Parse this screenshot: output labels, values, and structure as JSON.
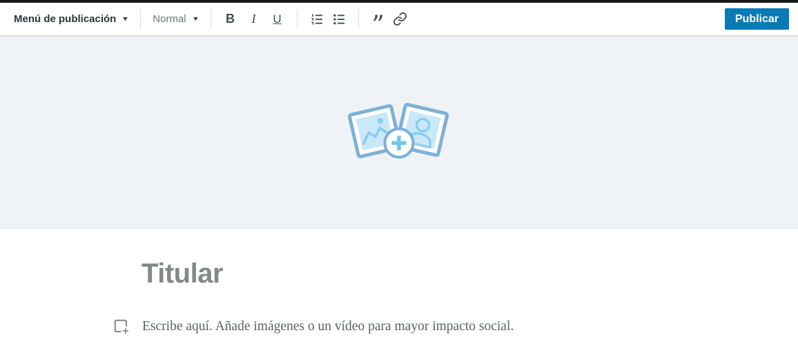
{
  "toolbar": {
    "publish_menu": {
      "label": "Menú de publicación"
    },
    "paragraph_style": {
      "label": "Normal"
    },
    "formatting": {
      "bold": "B",
      "italic": "I",
      "underline": "U"
    },
    "publish_button": {
      "label": "Publicar"
    }
  },
  "icons": {
    "chevron_down_glyph": "▼",
    "quote_glyph": "”",
    "ordered_list": "ordered-list-icon",
    "unordered_list": "unordered-list-icon",
    "link": "link-icon",
    "cover_upload": "add-images-icon",
    "inline_add_media": "add-media-icon"
  },
  "editor": {
    "title_placeholder": "Titular",
    "body_placeholder": "Escribe aquí. Añade imágenes o un vídeo para mayor impacto social."
  },
  "colors": {
    "top_bar": "#17191d",
    "publish_blue": "#0a7ab6",
    "cover_background": "#f0f3f6",
    "photo_frame_stroke": "#7cb1d5",
    "photo_fill": "#c9e8f8",
    "photo_detail_blue": "#8bcdee",
    "plus_blue": "#6fc6ef",
    "toolbar_icon_gray": "#44484d",
    "title_gray": "#85878a",
    "body_text_gray": "#5d6063"
  }
}
